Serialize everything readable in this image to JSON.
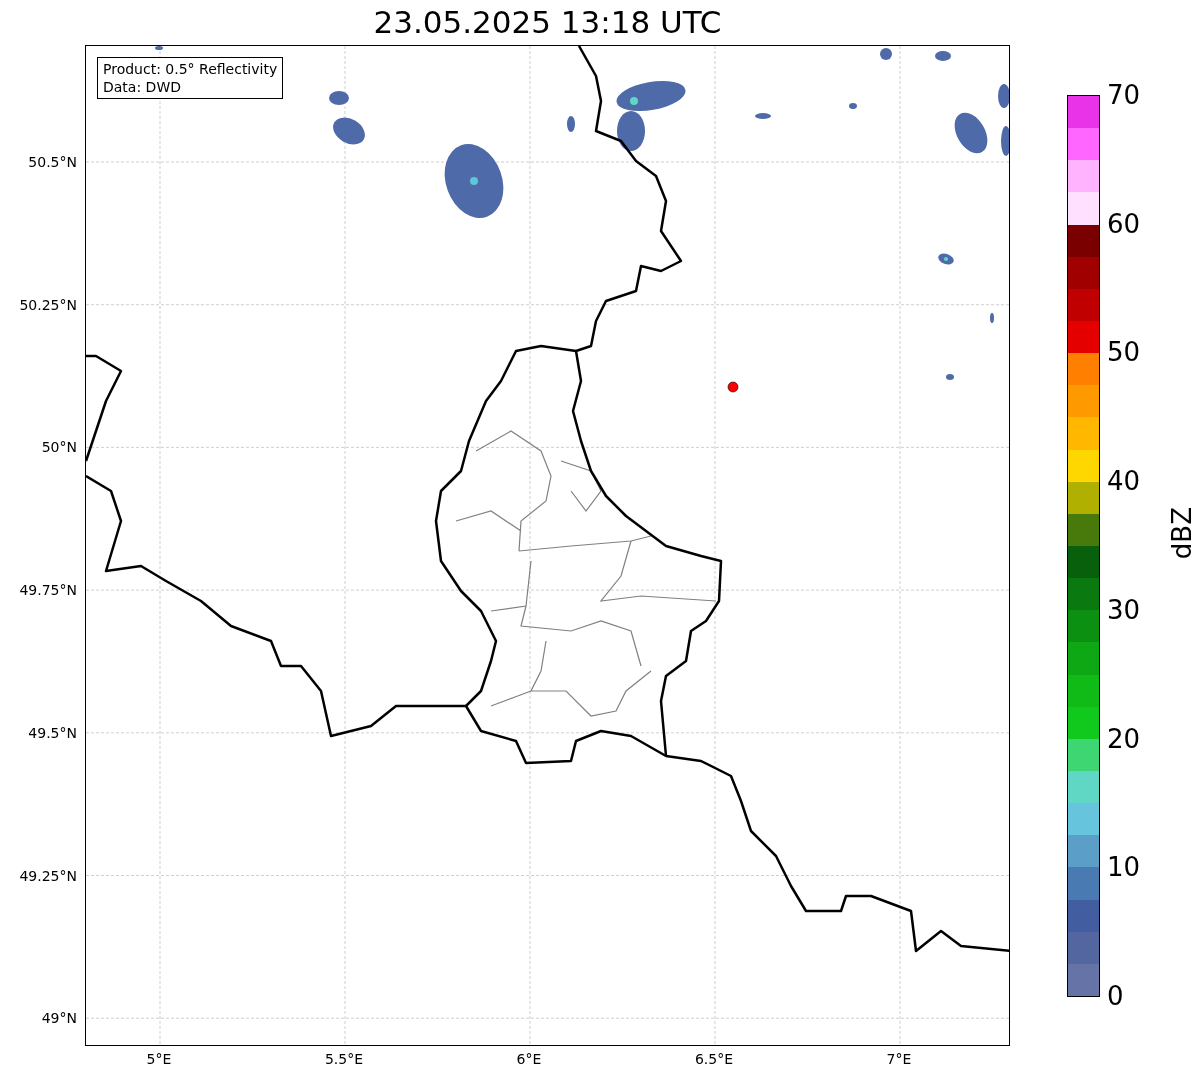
{
  "title": "23.05.2025 13:18 UTC",
  "info_box": {
    "lines": [
      "Product: 0.5° Reflectivity",
      "Data: DWD"
    ]
  },
  "map": {
    "latitude_labels": [
      "50.5°N",
      "50.25°N",
      "50°N",
      "49.75°N",
      "49.5°N",
      "49.25°N",
      "49°N"
    ],
    "longitude_labels": [
      "5°E",
      "5.5°E",
      "6°E",
      "6.5°E",
      "7°E"
    ]
  },
  "colorbar": {
    "label": "dBZ",
    "ticks": [
      "70",
      "60",
      "50",
      "40",
      "30",
      "20",
      "10",
      "0"
    ],
    "segments": [
      {
        "color": "#e833e8"
      },
      {
        "color": "#ff66ff"
      },
      {
        "color": "#ffb3ff"
      },
      {
        "color": "#ffe0ff"
      },
      {
        "color": "#7a0000"
      },
      {
        "color": "#a00000"
      },
      {
        "color": "#c00000"
      },
      {
        "color": "#e50000"
      },
      {
        "color": "#ff7f00"
      },
      {
        "color": "#ff9900"
      },
      {
        "color": "#ffb700"
      },
      {
        "color": "#ffd700"
      },
      {
        "color": "#b0b000"
      },
      {
        "color": "#477a0a"
      },
      {
        "color": "#085f0c"
      },
      {
        "color": "#0a7a10"
      },
      {
        "color": "#0c9012"
      },
      {
        "color": "#0ea814"
      },
      {
        "color": "#10bb18"
      },
      {
        "color": "#10c91c"
      },
      {
        "color": "#3dd672"
      },
      {
        "color": "#60d7c4"
      },
      {
        "color": "#66c4dd"
      },
      {
        "color": "#5b9fc9"
      },
      {
        "color": "#4a7ab2"
      },
      {
        "color": "#425ea1"
      },
      {
        "color": "#5466a0"
      },
      {
        "color": "#6673a6"
      }
    ]
  }
}
